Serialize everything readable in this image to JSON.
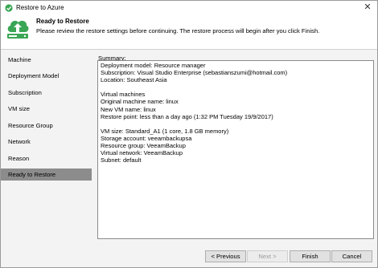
{
  "window": {
    "title": "Restore to Azure",
    "close_glyph": "✕"
  },
  "header": {
    "title": "Ready to Restore",
    "subtitle": "Please review the restore settings before continuing. The restore process will begin after you click Finish."
  },
  "sidebar": {
    "items": [
      {
        "label": "Machine",
        "active": false
      },
      {
        "label": "Deployment Model",
        "active": false
      },
      {
        "label": "Subscription",
        "active": false
      },
      {
        "label": "VM size",
        "active": false
      },
      {
        "label": "Resource Group",
        "active": false
      },
      {
        "label": "Network",
        "active": false
      },
      {
        "label": "Reason",
        "active": false
      },
      {
        "label": "Ready to Restore",
        "active": true
      }
    ]
  },
  "summary": {
    "label": "Summary:",
    "text": "Deployment model: Resource manager\nSubscription: Visual Studio Enterprise (sebastianszumi@hotmail.com)\nLocation: Southeast Asia\n\nVirtual machines\nOriginal machine name: linux\nNew VM name: linux\nRestore point: less than a day ago (1:32 PM Tuesday 19/9/2017)\n\nVM size: Standard_A1 (1 core, 1.8 GB memory)\nStorage account: veeambackupsa\nResource group: VeeamBackup\nVirtual network: VeeamBackup\nSubnet: default"
  },
  "footer": {
    "previous_label": "< Previous",
    "next_label": "Next >",
    "finish_label": "Finish",
    "cancel_label": "Cancel"
  },
  "colors": {
    "accent_green": "#3aa655",
    "sidebar_active": "#8c8c8c",
    "panel_bg": "#f3f3f3"
  }
}
